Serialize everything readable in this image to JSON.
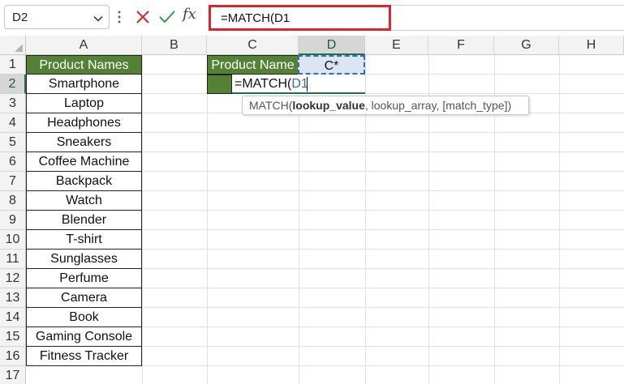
{
  "namebox": {
    "value": "D2"
  },
  "formula_bar": {
    "cancel_icon": "x-icon",
    "enter_icon": "check-icon",
    "fx_label": "fx",
    "formula": "=MATCH(D1"
  },
  "columns": [
    "A",
    "B",
    "C",
    "D",
    "E",
    "F",
    "G",
    "H"
  ],
  "rows": [
    "1",
    "2",
    "3",
    "4",
    "5",
    "6",
    "7",
    "8",
    "9",
    "10",
    "11",
    "12",
    "13",
    "14",
    "15",
    "16",
    "17"
  ],
  "columnA": {
    "header": "Product Names",
    "items": [
      "Smartphone",
      "Laptop",
      "Headphones",
      "Sneakers",
      "Coffee Machine",
      "Backpack",
      "Watch",
      "Blender",
      "T-shirt",
      "Sunglasses",
      "Perfume",
      "Camera",
      "Book",
      "Gaming Console",
      "Fitness Tracker"
    ]
  },
  "cells": {
    "C1": "Product Name",
    "D1": "C*",
    "D2_prefix": "=MATCH(",
    "D2_ref": "D1"
  },
  "tooltip": {
    "func": "MATCH(",
    "arg1": "lookup_value",
    "rest": ", lookup_array, [match_type])"
  },
  "colors": {
    "accent_green": "#548235",
    "formula_highlight": "#e0242c",
    "ref_blue": "#2e6bc4"
  }
}
